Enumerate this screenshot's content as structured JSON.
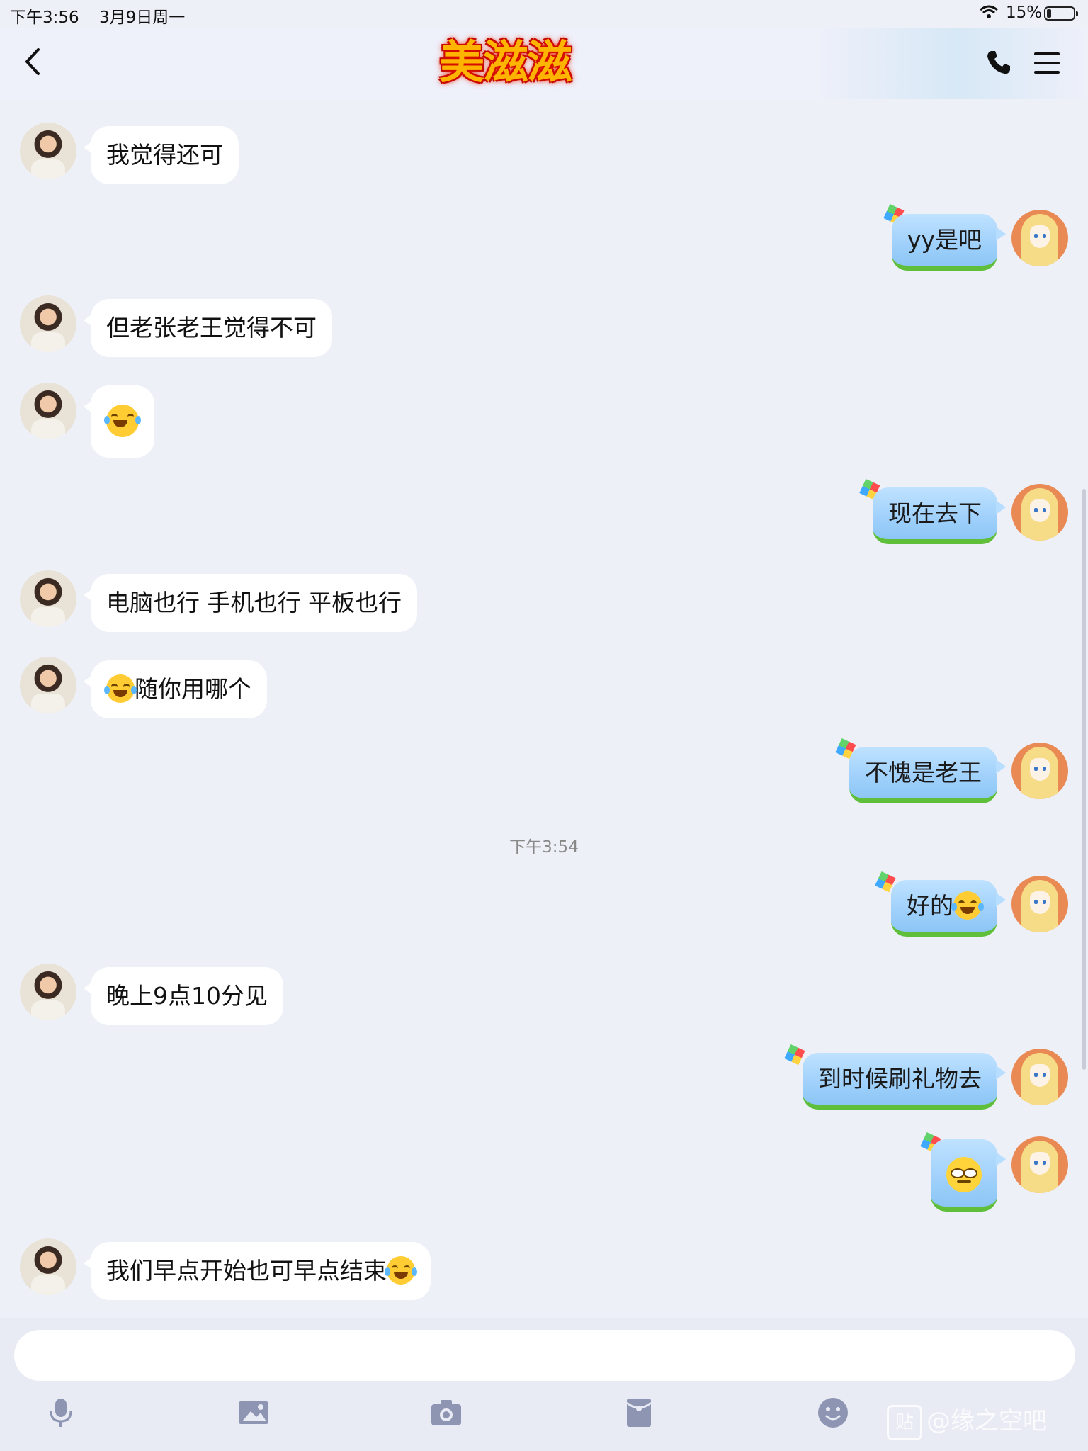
{
  "status_bar": {
    "time": "下午3:56",
    "date": "3月9日周一",
    "battery_text": "15%"
  },
  "header": {
    "title": "美滋滋"
  },
  "messages": [
    {
      "side": "left",
      "text": "我觉得还可"
    },
    {
      "side": "right",
      "text": "yy是吧"
    },
    {
      "side": "left",
      "text": "但老张老王觉得不可"
    },
    {
      "side": "left",
      "text": "",
      "emoji": "tears-of-joy-emoji"
    },
    {
      "side": "right",
      "text": "现在去下"
    },
    {
      "side": "left",
      "text": "电脑也行 手机也行 平板也行"
    },
    {
      "side": "left",
      "text": "随你用哪个",
      "emoji_prefix": "tears-of-joy-emoji"
    },
    {
      "side": "right",
      "text": "不愧是老王"
    },
    {
      "side": "right",
      "text": "好的",
      "emoji_suffix": "tears-of-joy-emoji"
    },
    {
      "side": "left",
      "text": "晚上9点10分见"
    },
    {
      "side": "right",
      "text": "到时候刷礼物去"
    },
    {
      "side": "right",
      "text": "",
      "emoji": "smirk-emoji"
    },
    {
      "side": "left",
      "text": "我们早点开始也可早点结束",
      "emoji_suffix": "tears-of-joy-emoji"
    }
  ],
  "timestamp": "下午3:54",
  "toolbar": {
    "icons": [
      "microphone-icon",
      "image-icon",
      "camera-icon",
      "red-packet-icon",
      "emoji-icon"
    ]
  },
  "watermark": {
    "badge": "贴",
    "text": "@缘之空吧"
  }
}
